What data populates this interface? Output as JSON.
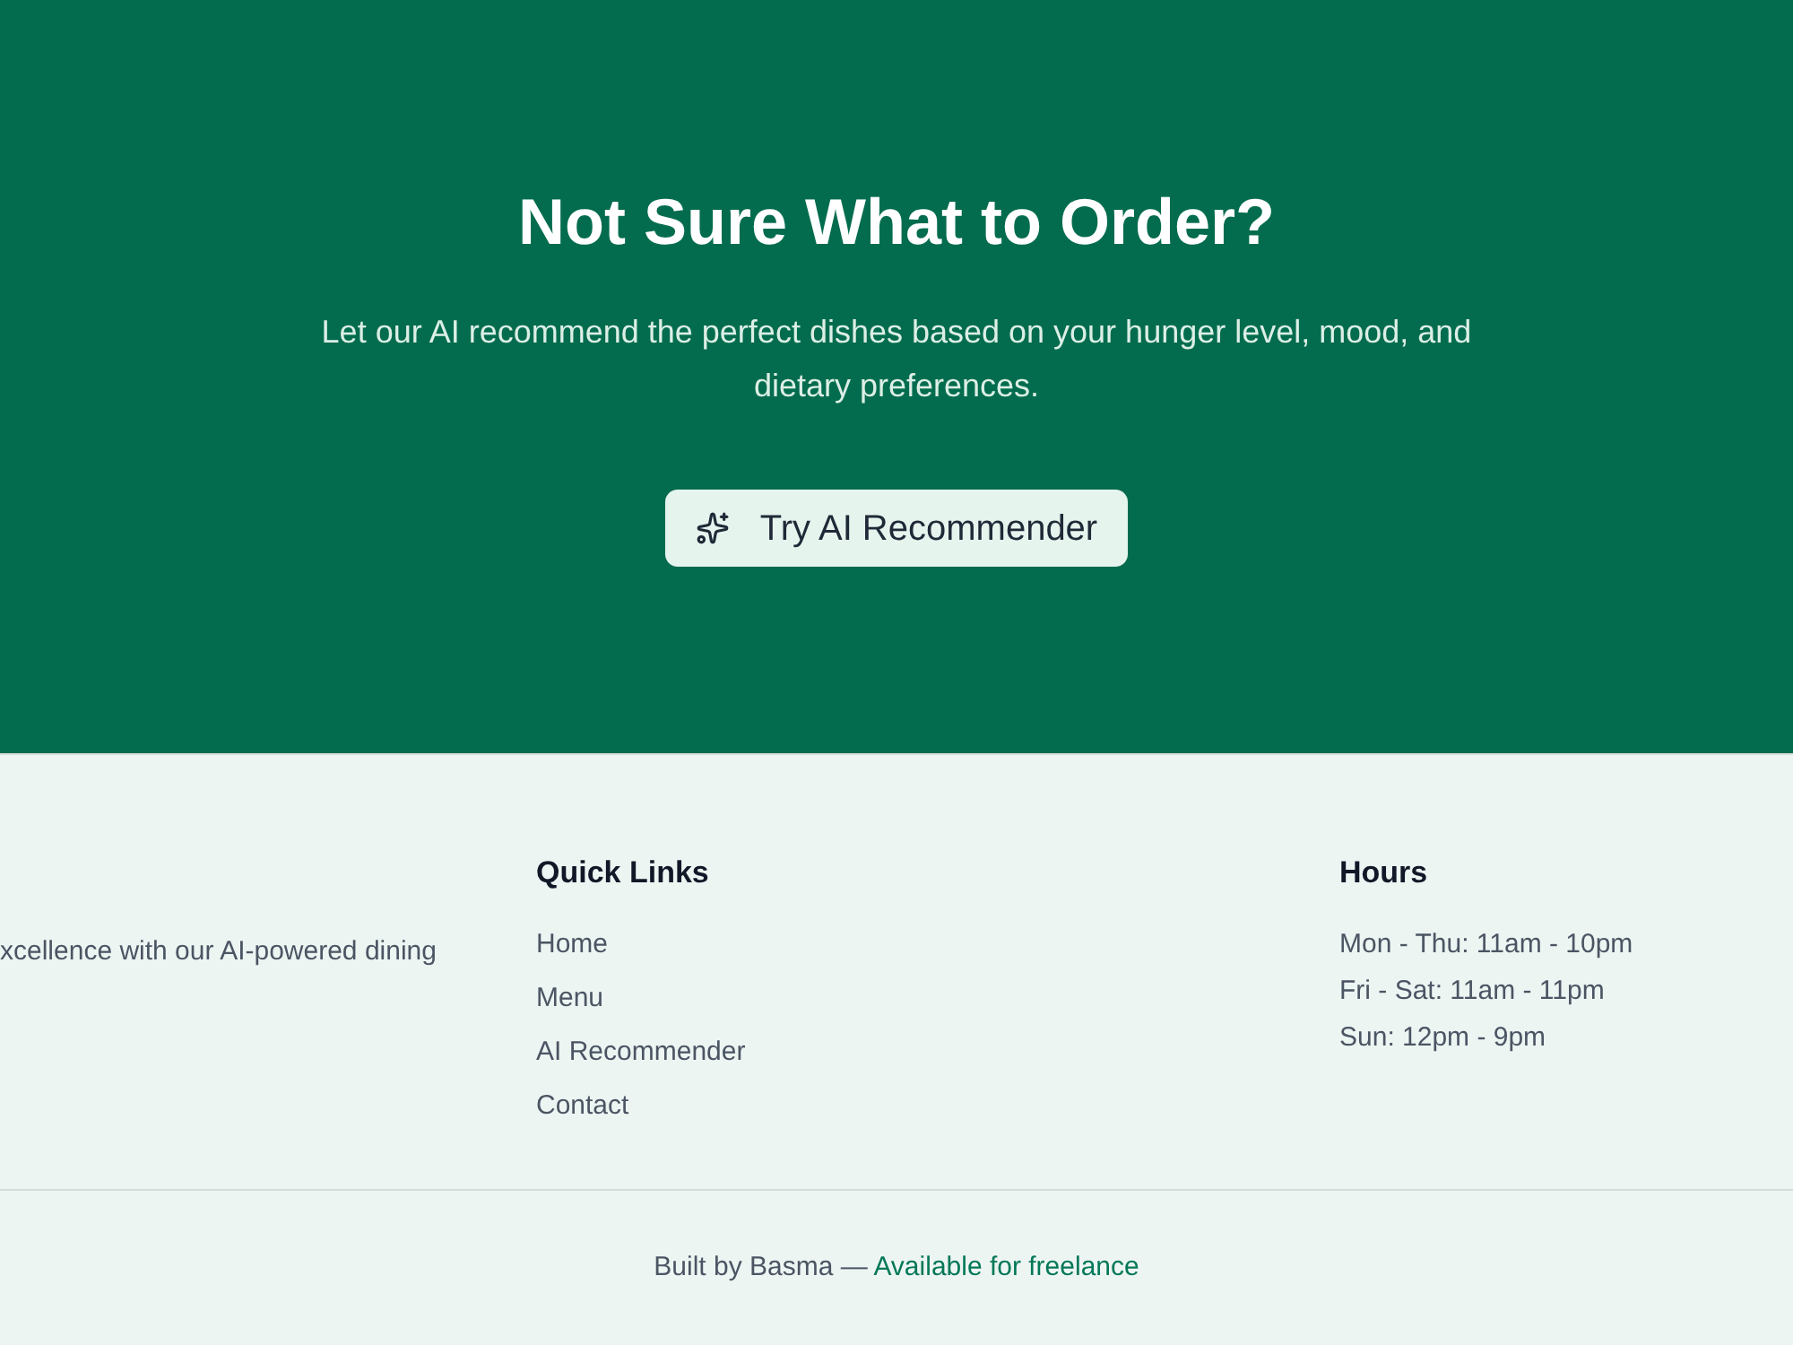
{
  "hero": {
    "title": "Not Sure What to Order?",
    "subtitle": "Let our AI recommend the perfect dishes based on your hunger level, mood, and dietary preferences.",
    "button": {
      "label": "Try AI Recommender"
    }
  },
  "footer": {
    "about": {
      "text": "xcellence with our AI-powered dining"
    },
    "columns": [
      {
        "heading": "Quick Links",
        "kind": "links",
        "items": [
          "Home",
          "Menu",
          "AI Recommender",
          "Contact"
        ]
      },
      {
        "heading": "Hours",
        "kind": "list",
        "items": [
          "Mon - Thu: 11am - 10pm",
          "Fri - Sat: 11am - 11pm",
          "Sun: 12pm - 9pm"
        ]
      }
    ],
    "credit": {
      "text": "Built by Basma —",
      "link": "Available for freelance"
    }
  }
}
